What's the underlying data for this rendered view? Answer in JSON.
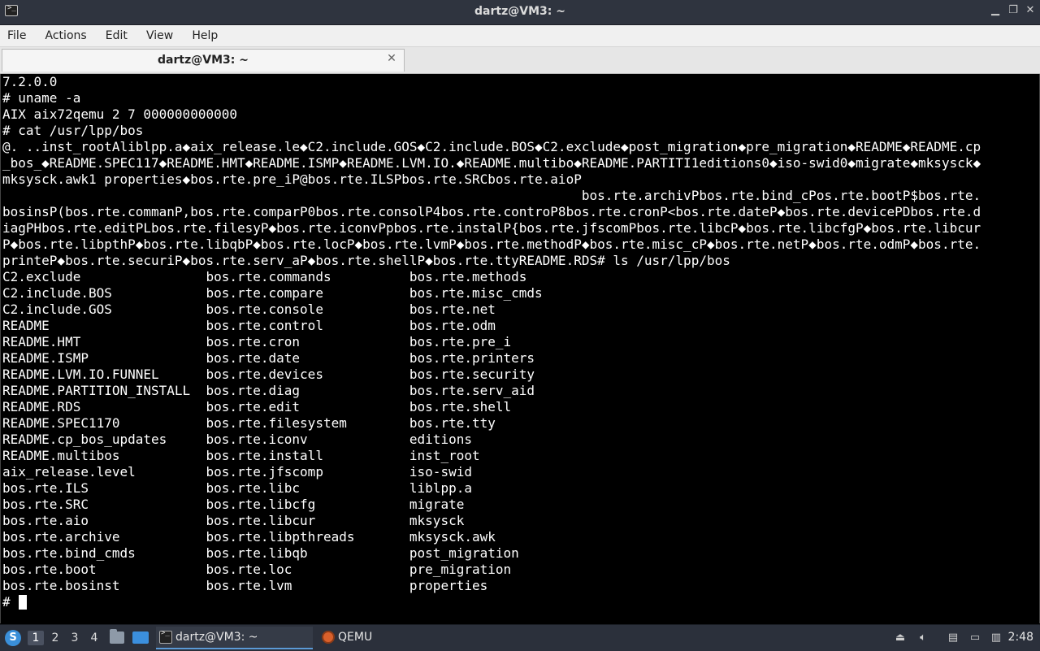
{
  "window": {
    "title": "dartz@VM3: ~",
    "minimize_glyph": "▁",
    "maximize_glyph": "❐",
    "close_glyph": "✕"
  },
  "menubar": {
    "items": [
      {
        "label": "File"
      },
      {
        "label": "Actions"
      },
      {
        "label": "Edit"
      },
      {
        "label": "View"
      },
      {
        "label": "Help"
      }
    ]
  },
  "tabs": [
    {
      "label": "dartz@VM3: ~",
      "active": true
    }
  ],
  "terminal": {
    "lines": [
      "7.2.0.0",
      "# uname -a",
      "AIX aix72qemu 2 7 000000000000",
      "# cat /usr/lpp/bos",
      "@. ..inst_rootAliblpp.a◆aix_release.le◆C2.include.GOS◆C2.include.BOS◆C2.exclude◆post_migration◆pre_migration◆README◆README.cp",
      "_bos_◆README.SPEC117◆README.HMT◆README.ISMP◆README.LVM.IO.◆README.multibo◆README.PARTITI1editions0◆iso-swid0◆migrate◆mksysck◆",
      "mksysck.awk1 properties◆bos.rte.pre_iP@bos.rte.ILSPbos.rte.SRCbos.rte.aioP",
      "                                                                          bos.rte.archivPbos.rte.bind_cPos.rte.bootP$bos.rte.",
      "bosinsP(bos.rte.commanP,bos.rte.comparP0bos.rte.consolP4bos.rte.controP8bos.rte.cronP<bos.rte.dateP◆bos.rte.devicePDbos.rte.d",
      "iagPHbos.rte.editPLbos.rte.filesyP◆bos.rte.iconvPpbos.rte.instalP{bos.rte.jfscomPbos.rte.libcP◆bos.rte.libcfgP◆bos.rte.libcur",
      "P◆bos.rte.libpthP◆bos.rte.libqbP◆bos.rte.locP◆bos.rte.lvmP◆bos.rte.methodP◆bos.rte.misc_cP◆bos.rte.netP◆bos.rte.odmP◆bos.rte.",
      "printeP◆bos.rte.securiP◆bos.rte.serv_aP◆bos.rte.shellP◆bos.rte.ttyREADME.RDS# ls /usr/lpp/bos",
      "C2.exclude                bos.rte.commands          bos.rte.methods",
      "C2.include.BOS            bos.rte.compare           bos.rte.misc_cmds",
      "C2.include.GOS            bos.rte.console           bos.rte.net",
      "README                    bos.rte.control           bos.rte.odm",
      "README.HMT                bos.rte.cron              bos.rte.pre_i",
      "README.ISMP               bos.rte.date              bos.rte.printers",
      "README.LVM.IO.FUNNEL      bos.rte.devices           bos.rte.security",
      "README.PARTITION_INSTALL  bos.rte.diag              bos.rte.serv_aid",
      "README.RDS                bos.rte.edit              bos.rte.shell",
      "README.SPEC1170           bos.rte.filesystem        bos.rte.tty",
      "README.cp_bos_updates     bos.rte.iconv             editions",
      "README.multibos           bos.rte.install           inst_root",
      "aix_release.level         bos.rte.jfscomp           iso-swid",
      "bos.rte.ILS               bos.rte.libc              liblpp.a",
      "bos.rte.SRC               bos.rte.libcfg            migrate",
      "bos.rte.aio               bos.rte.libcur            mksysck",
      "bos.rte.archive           bos.rte.libpthreads       mksysck.awk",
      "bos.rte.bind_cmds         bos.rte.libqb             post_migration",
      "bos.rte.boot              bos.rte.loc               pre_migration",
      "bos.rte.bosinst           bos.rte.lvm               properties"
    ],
    "prompt": "#"
  },
  "taskbar": {
    "workspaces": [
      "1",
      "2",
      "3",
      "4"
    ],
    "active_workspace": "1",
    "tasks": [
      {
        "label": "dartz@VM3: ~",
        "icon": "terminal-icon",
        "active": true
      },
      {
        "label": "QEMU",
        "icon": "qemu-icon",
        "active": false
      }
    ],
    "clock": "2:48"
  }
}
